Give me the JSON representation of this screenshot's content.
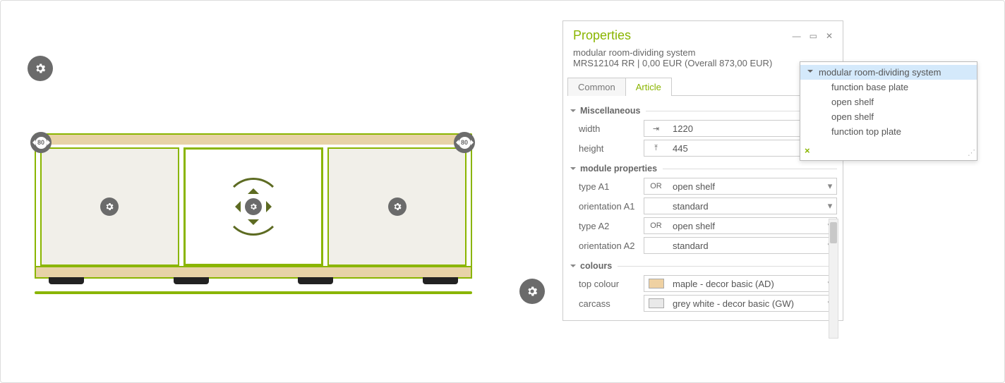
{
  "canvas": {
    "badge_value": "80"
  },
  "panel": {
    "title": "Properties",
    "subtitle_line1": "modular room-dividing system",
    "subtitle_line2": "MRS12104 RR | 0,00 EUR (Overall 873,00 EUR)",
    "tabs": {
      "common": "Common",
      "article": "Article"
    },
    "groups": {
      "misc": {
        "title": "Miscellaneous",
        "width_label": "width",
        "width_value": "1220",
        "height_label": "height",
        "height_value": "445"
      },
      "module": {
        "title": "module properties",
        "typeA1_label": "type A1",
        "typeA1_code": "OR",
        "typeA1_value": "open shelf",
        "orientA1_label": "orientation A1",
        "orientA1_value": "standard",
        "typeA2_label": "type A2",
        "typeA2_code": "OR",
        "typeA2_value": "open shelf",
        "orientA2_label": "orientation A2",
        "orientA2_value": "standard"
      },
      "colours": {
        "title": "colours",
        "top_label": "top colour",
        "top_value": "maple - decor basic (AD)",
        "carcass_label": "carcass",
        "carcass_value": "grey white - decor basic (GW)"
      }
    }
  },
  "tree": {
    "items": [
      "modular room-dividing system",
      "function base plate",
      "open shelf",
      "open shelf",
      "function top plate"
    ]
  }
}
